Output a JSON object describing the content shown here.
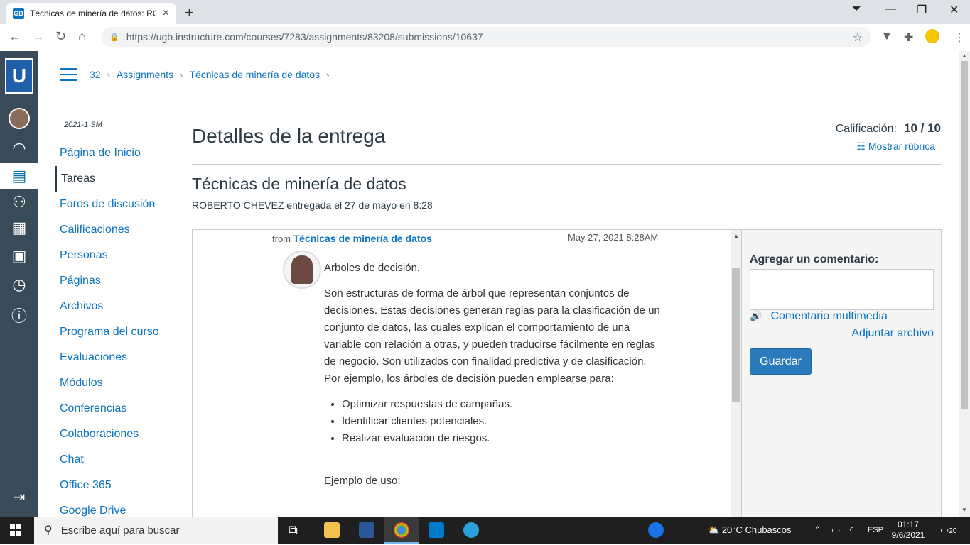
{
  "browser": {
    "tab_title": "Técnicas de minería de datos: RO",
    "favicon_text": "GB",
    "url": "https://ugb.instructure.com/courses/7283/assignments/83208/submissions/10637"
  },
  "breadcrumb": [
    "32",
    "Assignments",
    "Técnicas de minería de datos"
  ],
  "term": "2021-1 SM",
  "course_nav": [
    {
      "label": "Página de Inicio"
    },
    {
      "label": "Tareas",
      "active": true
    },
    {
      "label": "Foros de discusión"
    },
    {
      "label": "Calificaciones"
    },
    {
      "label": "Personas"
    },
    {
      "label": "Páginas"
    },
    {
      "label": "Archivos"
    },
    {
      "label": "Programa del curso"
    },
    {
      "label": "Evaluaciones"
    },
    {
      "label": "Módulos"
    },
    {
      "label": "Conferencias"
    },
    {
      "label": "Colaboraciones"
    },
    {
      "label": "Chat"
    },
    {
      "label": "Office 365"
    },
    {
      "label": "Google Drive"
    }
  ],
  "page_title": "Detalles de la entrega",
  "grade": {
    "label": "Calificación:",
    "value": "10 / 10"
  },
  "rubric_link": "Mostrar rúbrica",
  "assignment_title": "Técnicas de minería de datos",
  "submitted_by": "ROBERTO CHEVEZ entregada el 27 de mayo en 8:28",
  "post": {
    "from_label": "from",
    "from_title": "Técnicas de minería de datos",
    "date": "May 27, 2021 8:28AM",
    "heading": "Arboles de decisión.",
    "paragraph": "Son estructuras de forma de árbol que representan conjuntos de decisiones. Estas decisiones generan reglas para la clasificación de un conjunto de datos, las cuales explican el comportamiento de una variable con relación a otras, y pueden traducirse fácilmente en reglas de negocio. Son utilizados con finalidad predictiva y de clasificación. Por ejemplo, los árboles de decisión pueden emplearse para:",
    "bullets": [
      "Optimizar respuestas de campañas.",
      "Identificar clientes potenciales.",
      "Realizar evaluación de riesgos."
    ],
    "example": "Ejemplo de uso:"
  },
  "comments": {
    "label": "Agregar un comentario:",
    "media": "Comentario multimedia",
    "attach": "Adjuntar archivo",
    "save": "Guardar"
  },
  "taskbar": {
    "search_placeholder": "Escribe aquí para buscar",
    "weather": "20°C  Chubascos",
    "lang": "ESP",
    "time": "01:17",
    "date": "9/6/2021",
    "notifications": "20"
  }
}
